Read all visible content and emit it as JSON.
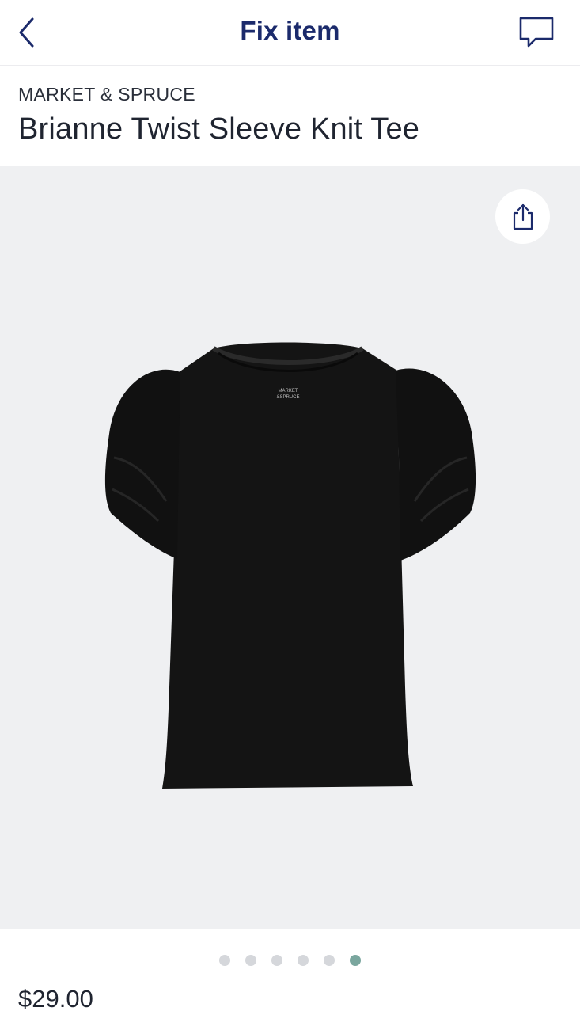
{
  "header": {
    "title": "Fix item",
    "back_icon": "chevron-left-icon",
    "chat_icon": "chat-bubble-icon"
  },
  "product": {
    "brand": "MARKET & SPRUCE",
    "name": "Brianne Twist Sleeve Knit Tee",
    "price": "$29.00",
    "shirt_tag_line1": "MARKET",
    "shirt_tag_line2": "&SPRUCE"
  },
  "gallery": {
    "share_icon": "share-icon",
    "image_count": 6,
    "active_index": 5
  },
  "colors": {
    "title": "#1b2a6b",
    "active_dot": "#7aa69e",
    "inactive_dot": "#d5d7db",
    "gallery_bg": "#eff0f2"
  }
}
